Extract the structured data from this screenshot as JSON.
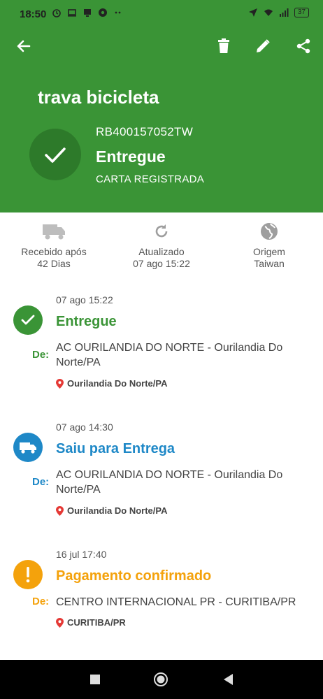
{
  "statusbar": {
    "time": "18:50",
    "battery": "37"
  },
  "header": {
    "title": "trava bicicleta",
    "tracking_code": "RB400157052TW",
    "status": "Entregue",
    "type": "CARTA REGISTRADA"
  },
  "info": {
    "received_line1": "Recebido após",
    "received_line2": "42 Dias",
    "updated_line1": "Atualizado",
    "updated_line2": "07 ago 15:22",
    "origin_line1": "Origem",
    "origin_line2": "Taiwan"
  },
  "events": [
    {
      "time": "07 ago 15:22",
      "status": "Entregue",
      "de": "De:",
      "from": "AC OURILANDIA DO NORTE - Ourilandia Do Norte/PA",
      "location": "Ourilandia Do Norte/PA",
      "color": "#3a9436",
      "icon": "check-icon"
    },
    {
      "time": "07 ago 14:30",
      "status": "Saiu para Entrega",
      "de": "De:",
      "from": "AC OURILANDIA DO NORTE - Ourilandia Do Norte/PA",
      "location": "Ourilandia Do Norte/PA",
      "color": "#1e88c7",
      "icon": "truck-icon"
    },
    {
      "time": "16 jul 17:40",
      "status": "Pagamento confirmado",
      "de": "De:",
      "from": "CENTRO INTERNACIONAL PR - CURITIBA/PR",
      "location": "CURITIBA/PR",
      "color": "#f4a20c",
      "icon": "exclamation-icon"
    }
  ],
  "colors": {
    "header": "#3a9436",
    "delivered": "#3a9436",
    "out_for_delivery": "#1e88c7",
    "payment": "#f4a20c",
    "pin": "#e53935"
  }
}
